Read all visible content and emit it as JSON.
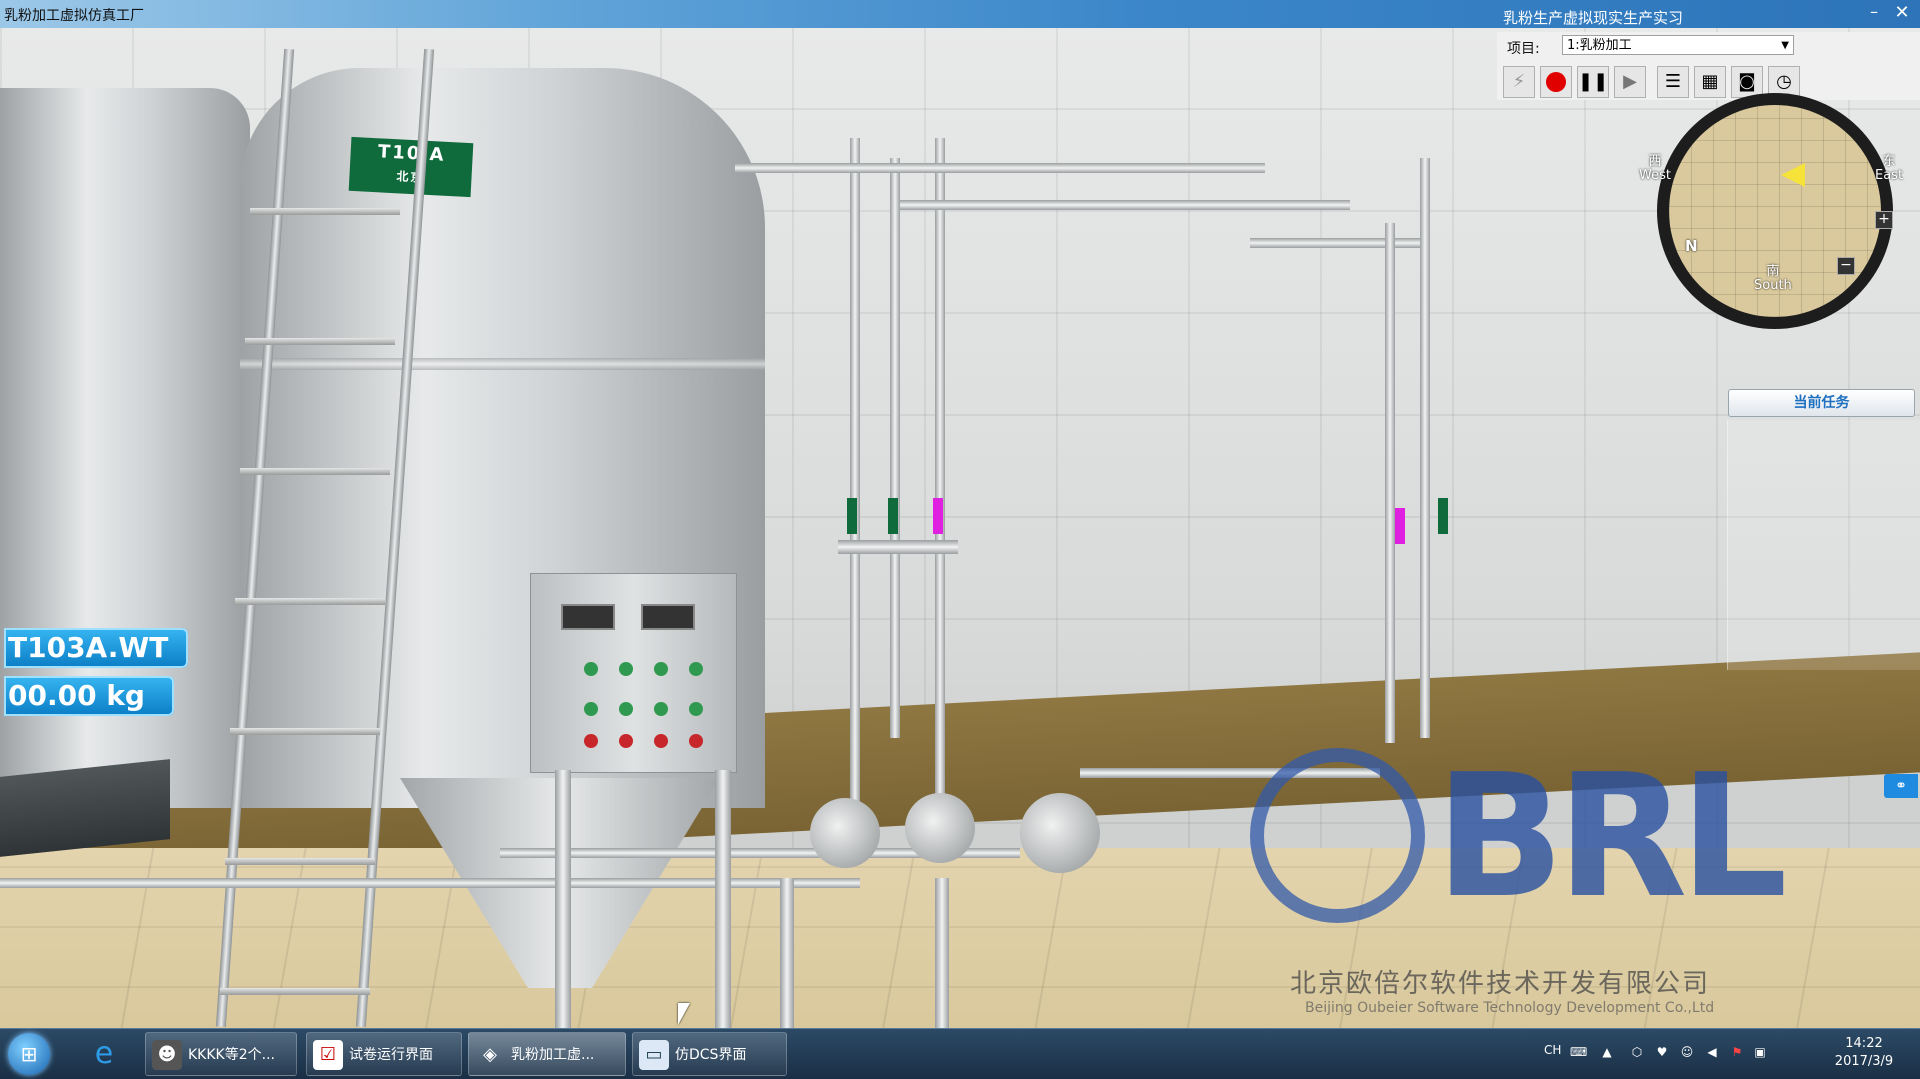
{
  "window": {
    "title": "乳粉加工虚拟仿真工厂"
  },
  "scene": {
    "tank_label_top": "T10 A",
    "tank_label_bottom": "北京",
    "weight_tag": "T103A.WT",
    "weight_value": "00.00 kg"
  },
  "right_panel": {
    "title": "乳粉生产虚拟现实生产实习",
    "minimize": "–",
    "close": "✕",
    "project_label": "项目:",
    "project_value": "1:乳粉加工",
    "toolbar": {
      "tool1_icon": "lightning-icon",
      "record_icon": "record-icon",
      "pause_icon": "pause-icon",
      "play_icon": "play-icon",
      "menu_icon": "list-icon",
      "chart_icon": "chart-icon",
      "camera_icon": "camera-icon",
      "clock_icon": "clock-icon"
    },
    "compass": {
      "west_cn": "西",
      "west_en": "West",
      "east_cn": "东",
      "east_en": "East",
      "south_cn": "南",
      "south_en": "South",
      "north": "N",
      "zoom_in": "+",
      "zoom_out": "−"
    },
    "current_task": "当前任务"
  },
  "watermark": {
    "logo_text": "BRL",
    "company_cn": "北京欧倍尔软件技术开发有限公司",
    "company_en": "Beijing Oubeier Software Technology Development Co.,Ltd"
  },
  "taskbar": {
    "items": [
      {
        "label": "KKKK等2个..."
      },
      {
        "label": "试卷运行界面"
      },
      {
        "label": "乳粉加工虚..."
      },
      {
        "label": "仿DCS界面"
      }
    ],
    "tray_lang": "CH",
    "time": "14:22",
    "date": "2017/3/9"
  },
  "colors": {
    "accent_blue": "#1a8fe0",
    "tag_green": "#0f6b3c",
    "record_red": "#e00000",
    "pipe_magenta": "#e020e0"
  }
}
